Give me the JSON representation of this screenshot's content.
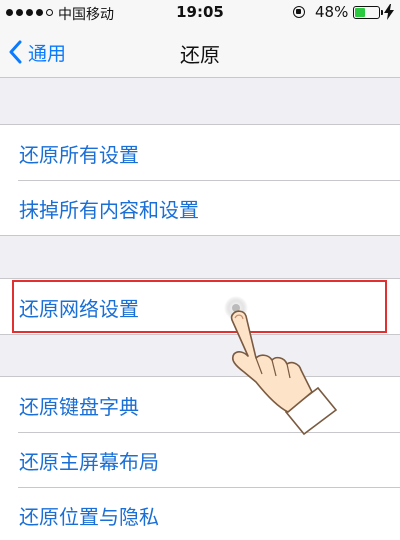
{
  "status_bar": {
    "carrier": "中国移动",
    "time": "19:05",
    "battery_percent": "48%",
    "battery_level": 0.48,
    "battery_color": "#2ac93f",
    "icons": [
      "signal-dots-icon",
      "orientation-lock-icon",
      "battery-icon",
      "charging-bolt-icon"
    ]
  },
  "nav": {
    "back_label": "通用",
    "title": "还原",
    "accent_color": "#0a7aff"
  },
  "groups": [
    {
      "items": [
        {
          "label": "还原所有设置"
        },
        {
          "label": "抹掉所有内容和设置"
        }
      ]
    },
    {
      "items": [
        {
          "label": "还原网络设置",
          "highlighted": true
        }
      ]
    },
    {
      "items": [
        {
          "label": "还原键盘字典"
        },
        {
          "label": "还原主屏幕布局"
        },
        {
          "label": "还原位置与隐私"
        }
      ]
    }
  ],
  "annotation": {
    "highlight_color": "#e03030",
    "pointer_icon": "tapping-hand-icon"
  }
}
